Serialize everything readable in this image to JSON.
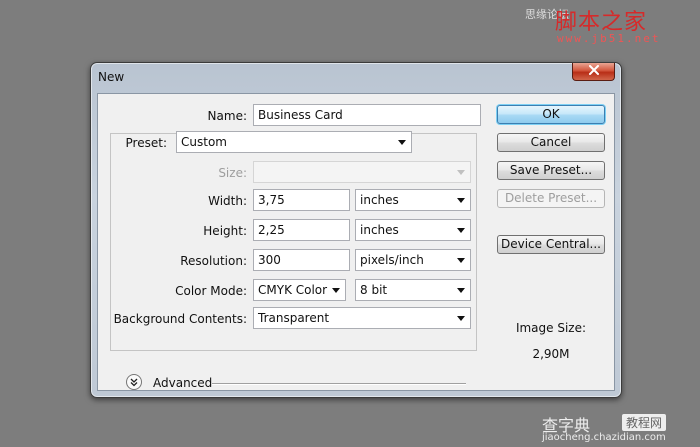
{
  "watermark_top": {
    "chinese_text": "思缘论坛",
    "logo": "脚本之家",
    "url": "www.jb51.net"
  },
  "watermark_bottom": {
    "logo": "查字典",
    "tag": "教程网",
    "url": "jiaocheng.chazidian.com"
  },
  "dialog": {
    "title": "New",
    "fields": {
      "name": {
        "label": "Name:",
        "value": "Business Card"
      },
      "preset": {
        "label": "Preset:",
        "value": "Custom"
      },
      "size": {
        "label": "Size:",
        "value": ""
      },
      "width": {
        "label": "Width:",
        "value": "3,75",
        "unit": "inches"
      },
      "height": {
        "label": "Height:",
        "value": "2,25",
        "unit": "inches"
      },
      "resolution": {
        "label": "Resolution:",
        "value": "300",
        "unit": "pixels/inch"
      },
      "color_mode": {
        "label": "Color Mode:",
        "value": "CMYK Color",
        "bit_depth": "8 bit"
      },
      "background": {
        "label": "Background Contents:",
        "value": "Transparent"
      }
    },
    "advanced_label": "Advanced",
    "buttons": {
      "ok": "OK",
      "cancel": "Cancel",
      "save_preset": "Save Preset...",
      "delete_preset": "Delete Preset...",
      "device_central": "Device Central..."
    },
    "image_size": {
      "label": "Image Size:",
      "value": "2,90M"
    }
  }
}
